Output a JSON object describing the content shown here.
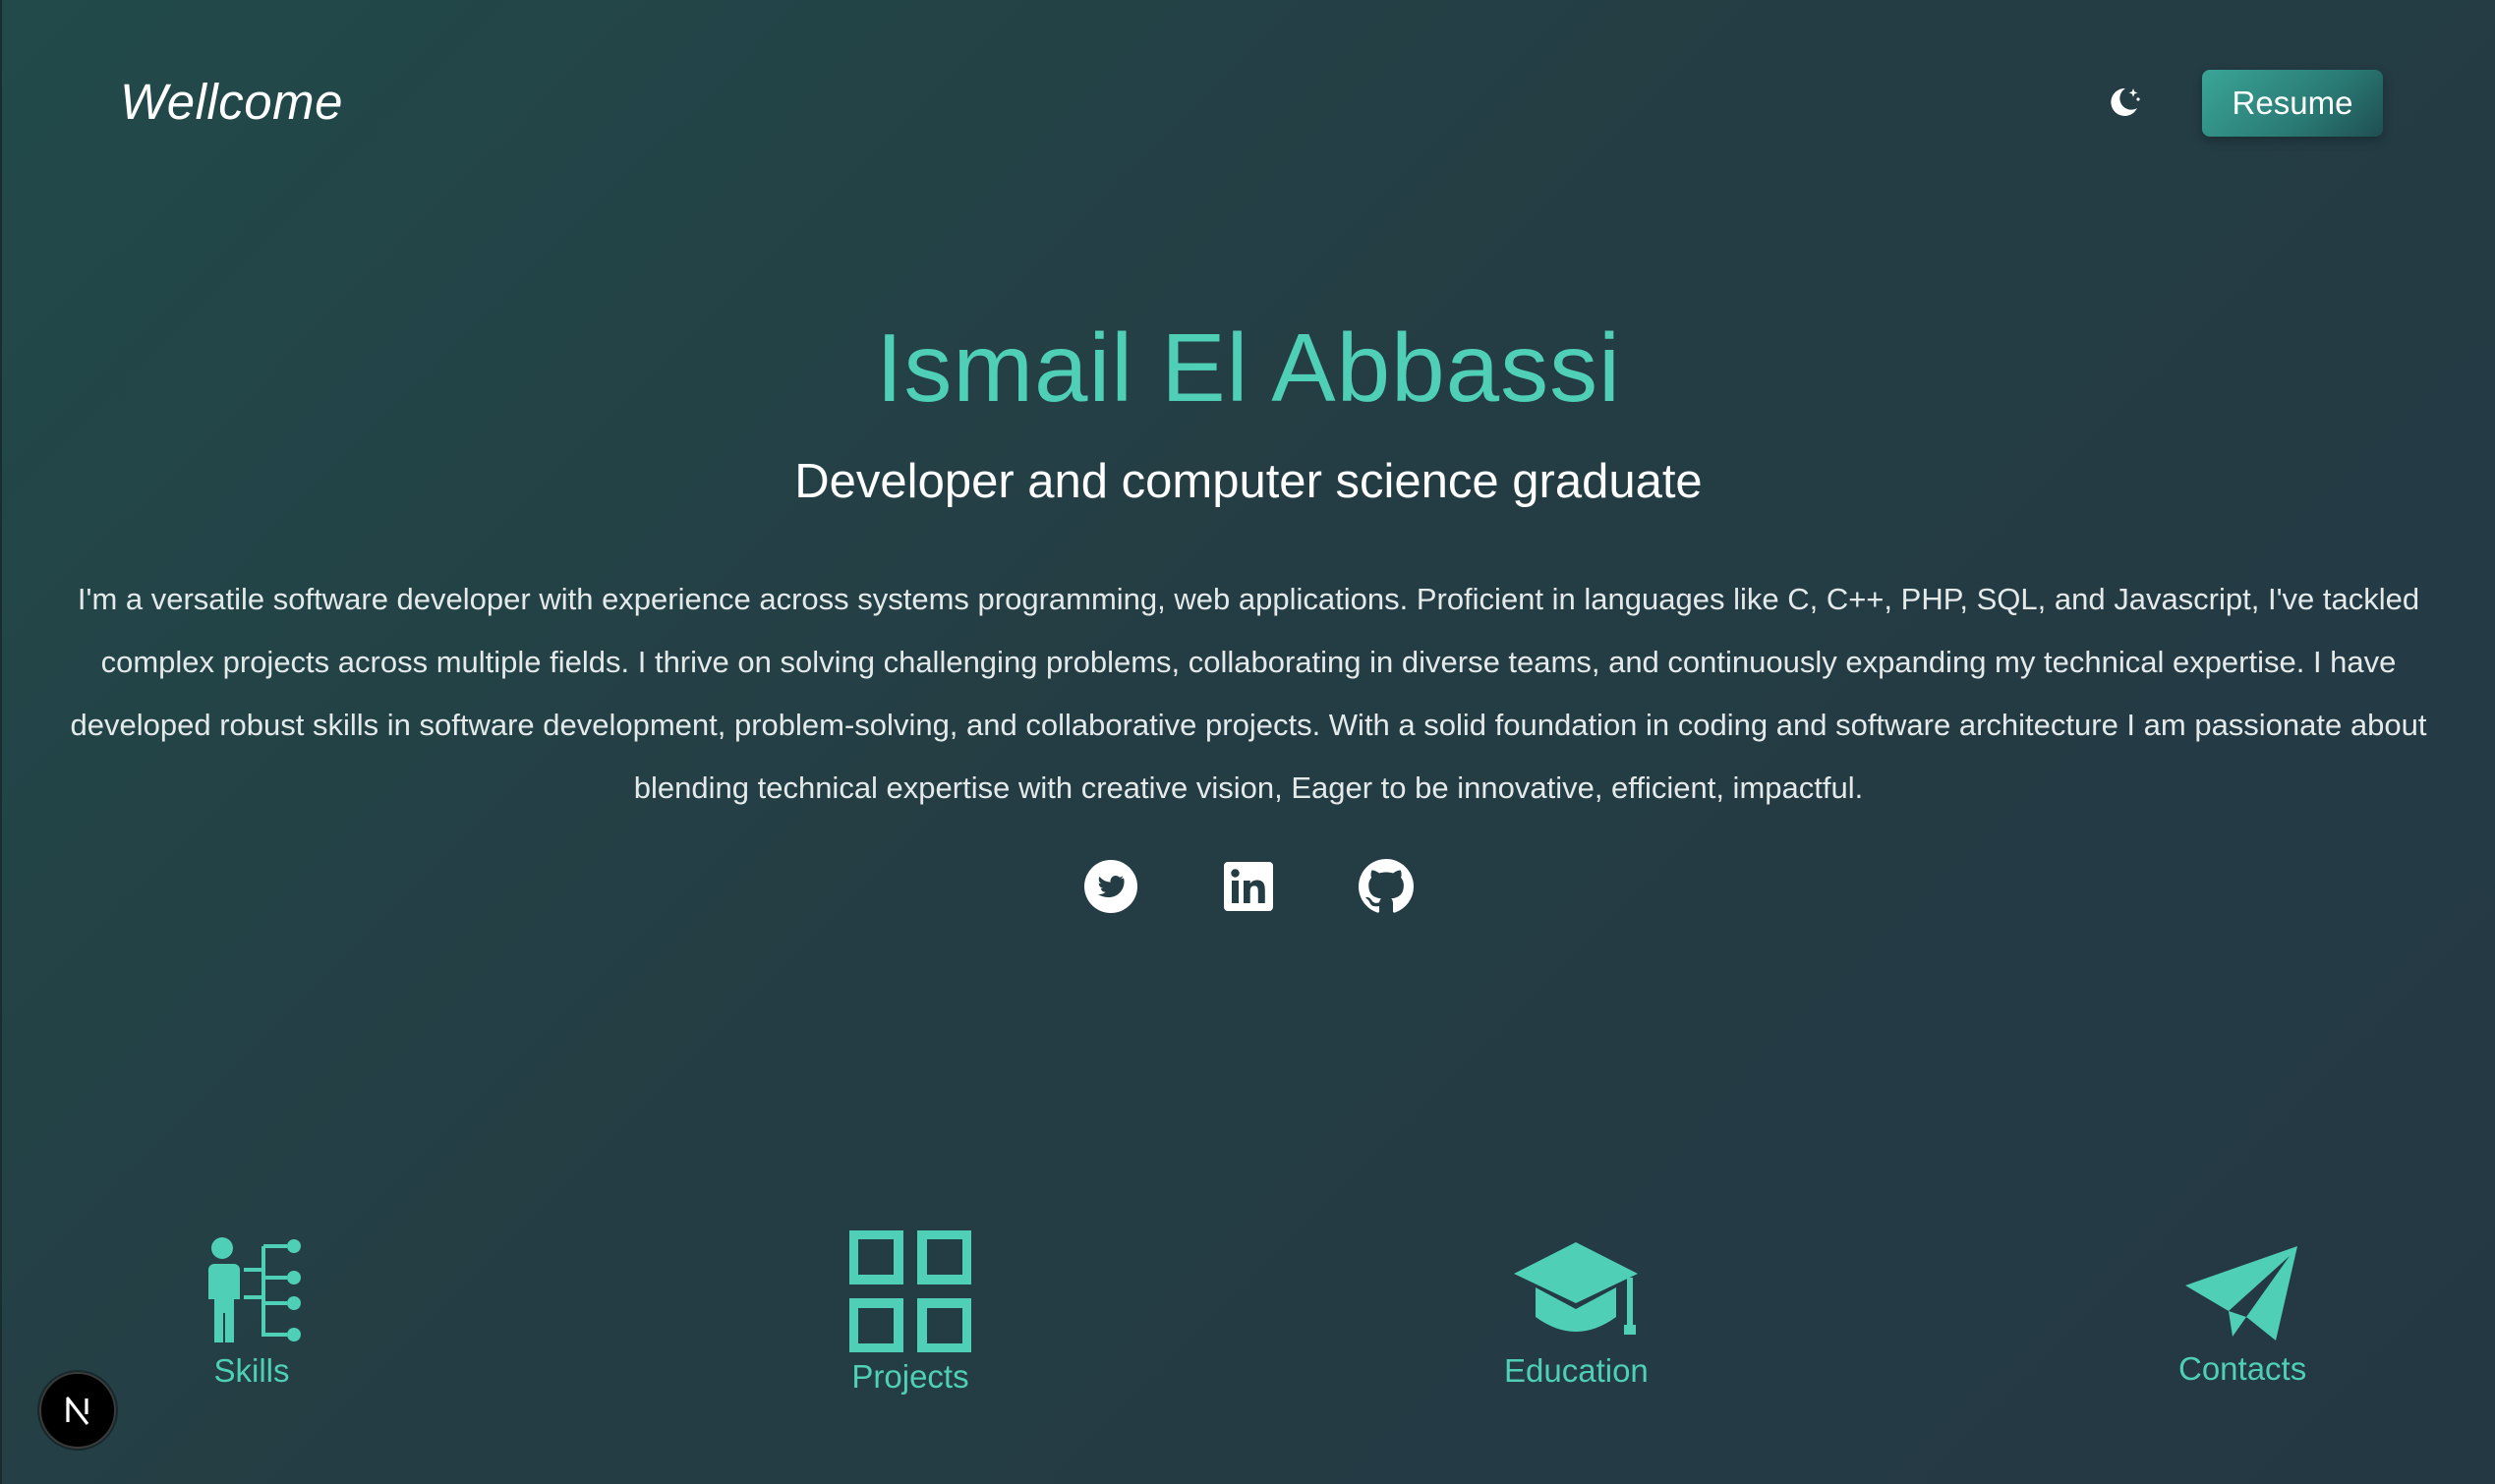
{
  "header": {
    "brand": "Wellcome",
    "theme_toggle_icon": "moon-stars-icon",
    "resume_label": "Resume"
  },
  "hero": {
    "name": "Ismail El Abbassi",
    "subtitle": "Developer and computer science graduate",
    "bio": "I'm a versatile software developer with experience across systems programming, web applications. Proficient in languages like C, C++, PHP, SQL, and Javascript, I've tackled complex projects across multiple fields. I thrive on solving challenging problems, collaborating in diverse teams, and continuously expanding my technical expertise. I have developed robust skills in software development, problem-solving, and collaborative projects. With a solid foundation in coding and software architecture I am passionate about blending technical expertise with creative vision, Eager to be innovative, efficient, impactful."
  },
  "socials": [
    {
      "icon": "twitter-icon"
    },
    {
      "icon": "linkedin-icon"
    },
    {
      "icon": "github-icon"
    }
  ],
  "nav": [
    {
      "label": "Skills",
      "icon": "skills-hierarchy-icon"
    },
    {
      "label": "Projects",
      "icon": "grid-icon"
    },
    {
      "label": "Education",
      "icon": "graduation-cap-icon"
    },
    {
      "label": "Contacts",
      "icon": "paper-plane-icon"
    }
  ],
  "colors": {
    "accent": "#4fcfb6",
    "background": "#243d44",
    "button": "#2a7a74"
  },
  "next_badge_icon": "nextjs-icon"
}
